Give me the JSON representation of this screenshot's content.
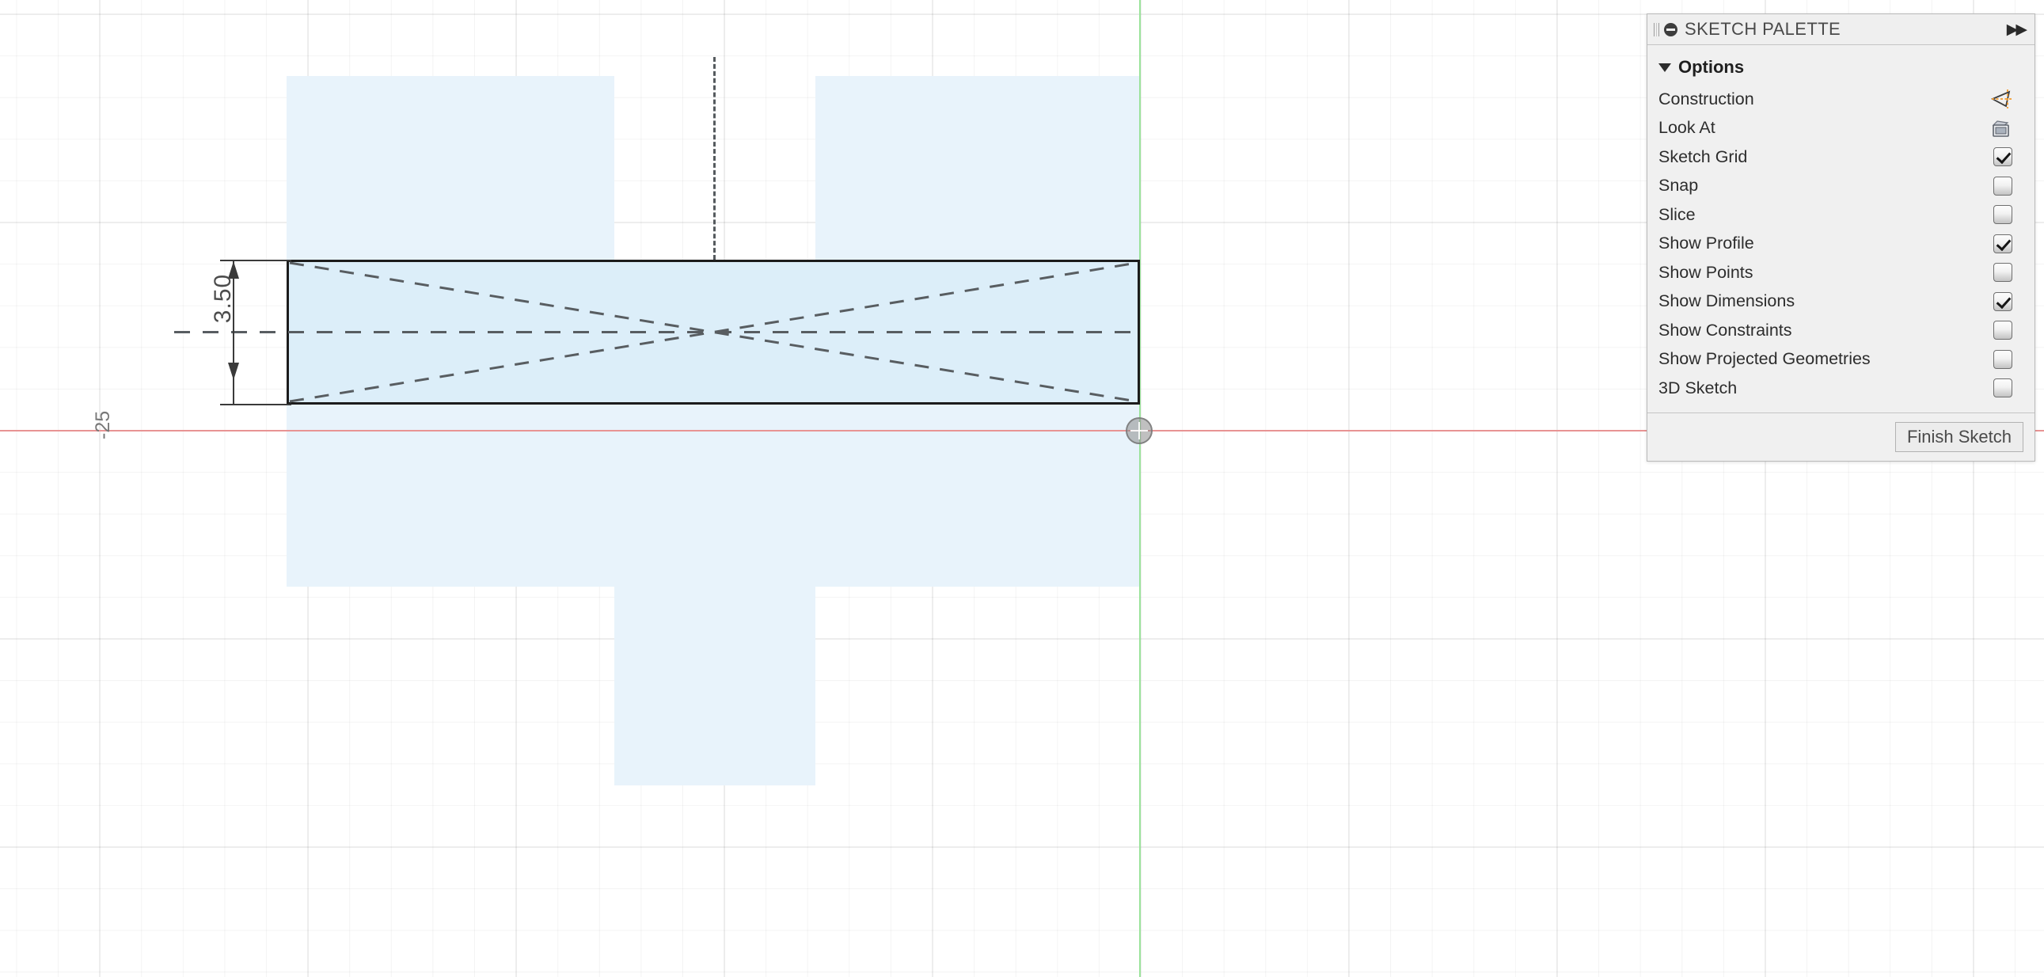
{
  "app": {
    "mode": "sketch",
    "colors": {
      "x_axis": "#e89393",
      "y_axis": "#9be39b",
      "profile_fill": "#e8f3fb",
      "sketch_line": "#1c1c1c",
      "construction": "#f29b2e",
      "grid_minor": "#f2f2f2",
      "grid_major": "#e6e6e6"
    }
  },
  "canvas": {
    "grid_label": "-25",
    "dimension": {
      "value": "3.50"
    }
  },
  "palette": {
    "title": "SKETCH PALETTE",
    "grip_icon": "drag-handle-icon",
    "minimize_icon": "minimize-icon",
    "collapse_icon": "▶▶",
    "section": {
      "label": "Options",
      "expand_icon": "triangle-down-icon"
    },
    "options": [
      {
        "label": "Construction",
        "control": "icon",
        "icon": "construction-geometry-icon",
        "checked": false
      },
      {
        "label": "Look At",
        "control": "icon",
        "icon": "look-at-icon",
        "checked": false
      },
      {
        "label": "Sketch Grid",
        "control": "checkbox",
        "icon": "checkbox-icon",
        "checked": true
      },
      {
        "label": "Snap",
        "control": "checkbox",
        "icon": "checkbox-icon",
        "checked": false
      },
      {
        "label": "Slice",
        "control": "checkbox",
        "icon": "checkbox-icon",
        "checked": false
      },
      {
        "label": "Show Profile",
        "control": "checkbox",
        "icon": "checkbox-icon",
        "checked": true
      },
      {
        "label": "Show Points",
        "control": "checkbox",
        "icon": "checkbox-icon",
        "checked": false
      },
      {
        "label": "Show Dimensions",
        "control": "checkbox",
        "icon": "checkbox-icon",
        "checked": true
      },
      {
        "label": "Show Constraints",
        "control": "checkbox",
        "icon": "checkbox-icon",
        "checked": false
      },
      {
        "label": "Show Projected Geometries",
        "control": "checkbox",
        "icon": "checkbox-icon",
        "checked": false
      },
      {
        "label": "3D Sketch",
        "control": "checkbox",
        "icon": "checkbox-icon",
        "checked": false
      }
    ],
    "footer": {
      "finish_label": "Finish Sketch"
    }
  }
}
